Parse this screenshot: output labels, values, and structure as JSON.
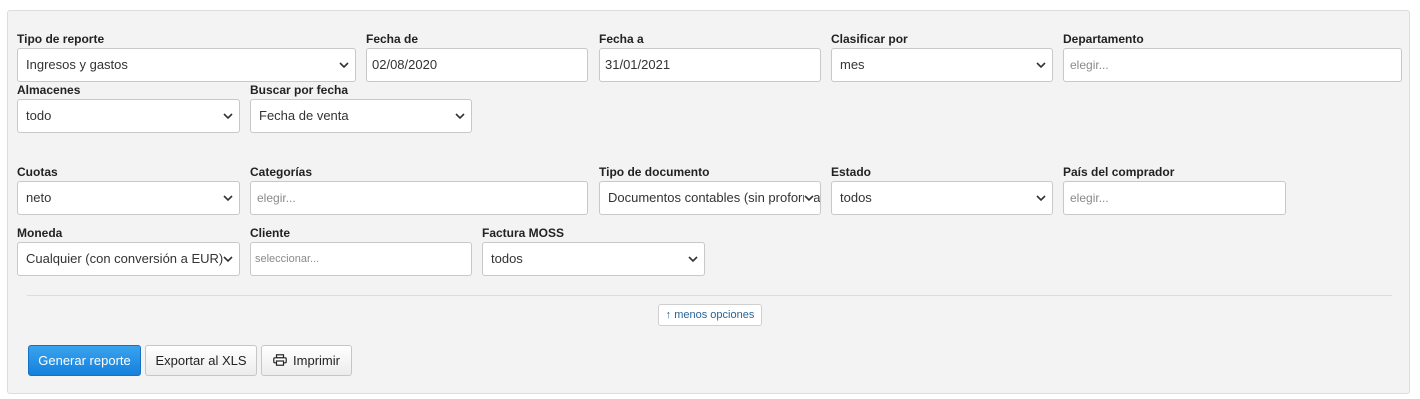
{
  "filters": {
    "tipo_reporte": {
      "label": "Tipo de reporte",
      "value": "Ingresos y gastos"
    },
    "fecha_de": {
      "label": "Fecha de",
      "value": "02/08/2020"
    },
    "fecha_a": {
      "label": "Fecha a",
      "value": "31/01/2021"
    },
    "clasificar_por": {
      "label": "Clasificar por",
      "value": "mes"
    },
    "departamento": {
      "label": "Departamento",
      "placeholder": "elegir..."
    },
    "almacenes": {
      "label": "Almacenes",
      "value": "todo"
    },
    "buscar_por_fecha": {
      "label": "Buscar por fecha",
      "value": "Fecha de venta"
    },
    "cuotas": {
      "label": "Cuotas",
      "value": "neto"
    },
    "categorias": {
      "label": "Categorías",
      "placeholder": "elegir..."
    },
    "tipo_documento": {
      "label": "Tipo de documento",
      "value": "Documentos contables (sin proformas)"
    },
    "estado": {
      "label": "Estado",
      "value": "todos"
    },
    "pais_comprador": {
      "label": "País del comprador",
      "placeholder": "elegir..."
    },
    "moneda": {
      "label": "Moneda",
      "value": "Cualquier (con conversión a EUR)"
    },
    "cliente": {
      "label": "Cliente",
      "placeholder": "seleccionar..."
    },
    "factura_moss": {
      "label": "Factura MOSS",
      "value": "todos"
    }
  },
  "toggle_options": {
    "label": "↑ menos opciones"
  },
  "actions": {
    "generate": "Generar reporte",
    "export_xls": "Exportar al XLS",
    "print": "Imprimir",
    "print_icon": "printer-icon"
  },
  "colors": {
    "primary": "#1a86e0",
    "panel_bg": "#f3f3f3",
    "link": "#2a6496"
  }
}
